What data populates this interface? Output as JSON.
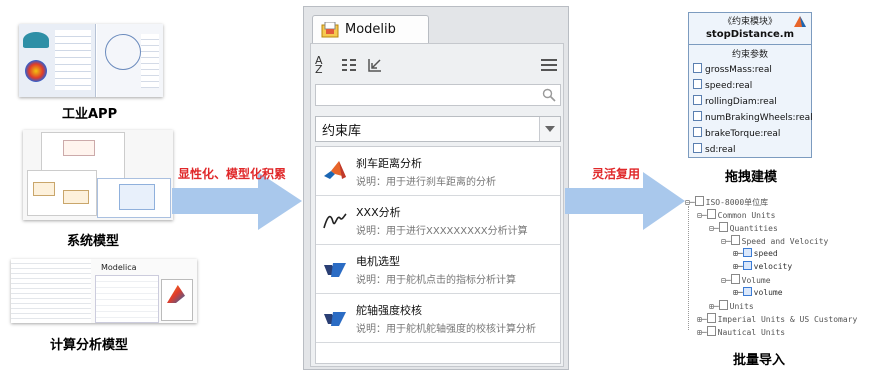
{
  "left": {
    "items": [
      {
        "label": "工业APP"
      },
      {
        "label": "系统模型"
      },
      {
        "label": "计算分析模型"
      }
    ],
    "modelica_text": "Modelica"
  },
  "arrows": {
    "left_label": "显性化、模型化积累",
    "right_label": "灵活复用"
  },
  "panel": {
    "tab_label": "Modelib",
    "toolbar": [
      "sort-az-icon",
      "filter-icon",
      "import-icon",
      "menu-icon"
    ],
    "search_placeholder": "",
    "select_value": "约束库",
    "items": [
      {
        "title": "刹车距离分析",
        "desc": "说明：用于进行刹车距离的分析",
        "icon": "matlab-icon"
      },
      {
        "title": "XXX分析",
        "desc": "说明：用于进行XXXXXXXXX分析计算",
        "icon": "curve-icon"
      },
      {
        "title": "电机选型",
        "desc": "说明：用于舵机点击的指标分析计算",
        "icon": "simulink-icon"
      },
      {
        "title": "舵轴强度校核",
        "desc": "说明：用于舵机舵轴强度的校核计算分析",
        "icon": "simulink-icon"
      }
    ]
  },
  "right": {
    "block": {
      "stereotype": "《约束模块》",
      "name": "stopDistance.m",
      "section": "约束参数",
      "params": [
        "grossMass:real",
        "speed:real",
        "rollingDiam:real",
        "numBrakingWheels:real",
        "brakeTorque:real",
        "sd:real"
      ]
    },
    "block_caption": "拖拽建模",
    "tree": [
      "ISO-8000单位库",
      "Common Units",
      "Quantities",
      "Speed and Velocity",
      "speed",
      "velocity",
      "Volume",
      "volume",
      "Units",
      "Imperial Units & US Customary",
      "Nautical Units"
    ],
    "tree_caption": "批量导入",
    "colors": {
      "accent": "#2b6cc4",
      "arrow": "#a9c8ec",
      "label_red": "#e0282a"
    }
  }
}
